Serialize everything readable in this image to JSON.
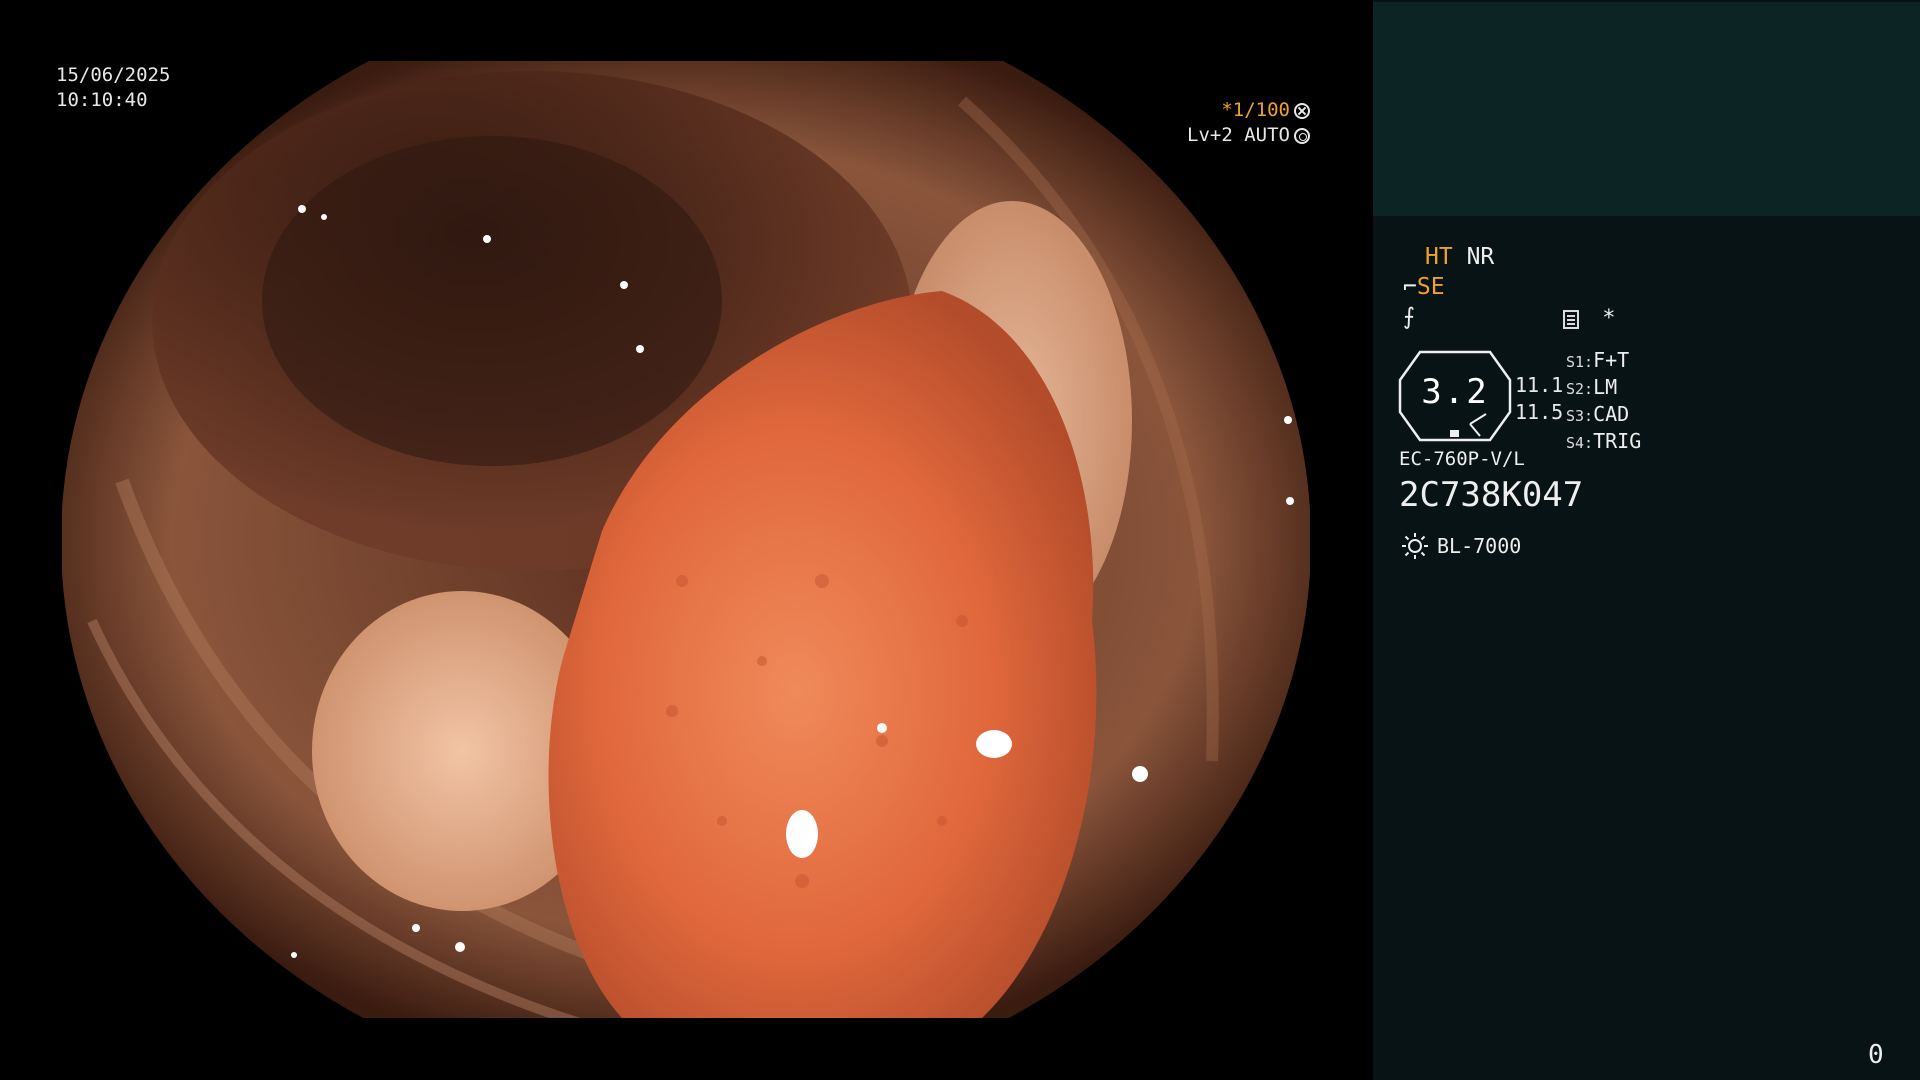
{
  "overlay": {
    "date": "15/06/2025",
    "time": "10:10:40",
    "shutter": "*1/100",
    "level": "Lv+2 AUTO"
  },
  "panel": {
    "mode_ht": "HT",
    "mode_nr": "NR",
    "mode_se": "SE",
    "mode_symbol1": "⌐",
    "mode_symbol2": "⨍",
    "star": "*",
    "zoom_value": "3.2",
    "bar_values": [
      "11.1",
      "11.5"
    ],
    "switches": [
      {
        "label": "S1:",
        "value": "F+T"
      },
      {
        "label": "S2:",
        "value": "LM"
      },
      {
        "label": "S3:",
        "value": "CAD"
      },
      {
        "label": "S4:",
        "value": "TRIG"
      }
    ],
    "scope_model": "EC-760P-V/L",
    "scope_serial": "2C738K047",
    "light_source": "BL-7000",
    "frame_counter": "0"
  },
  "colors": {
    "mucosa_dark": "#3a1f15",
    "mucosa_mid": "#7a4631",
    "polyp": "#e0673b",
    "panel_bg": "#071314",
    "preview_bg": "#0d2425",
    "accent_orange": "#f0a030"
  },
  "icons": {
    "shutter_icon": "aperture-icon",
    "level_icon": "ring-icon",
    "light_icon": "sun-icon",
    "record_icon": "document-icon"
  }
}
